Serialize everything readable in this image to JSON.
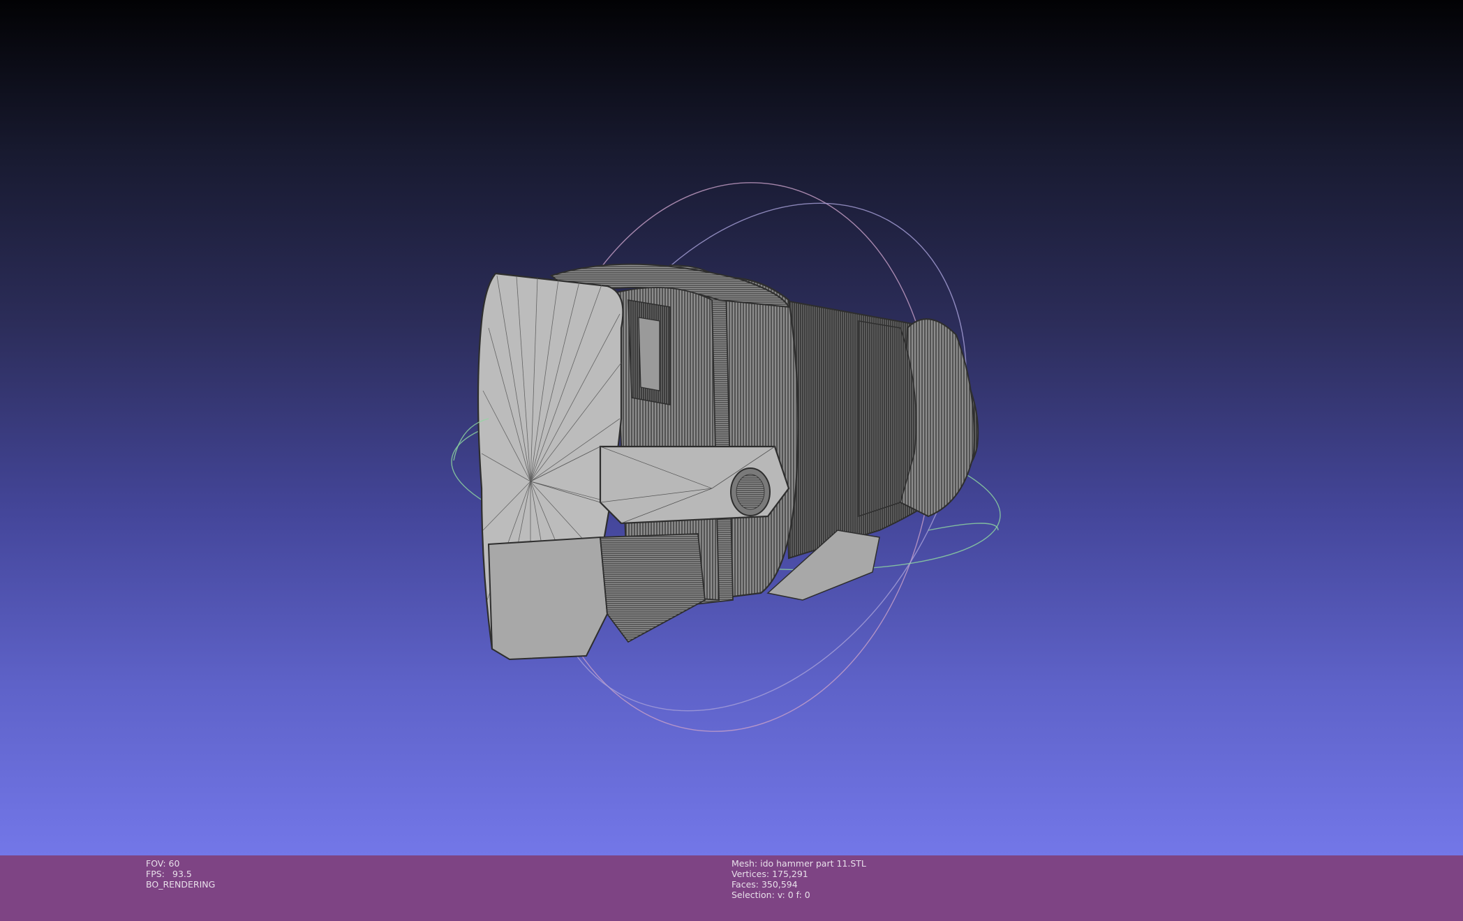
{
  "viewer": {
    "mesh_name": "ido hammer part 11.STL",
    "colors": {
      "background_top": "#020204",
      "background_bottom": "#7377e8",
      "statusbar": "#7e4484",
      "mesh_fill": "#b4b4b4",
      "mesh_lines": "#3c3c3c"
    }
  },
  "status_left": {
    "fov_label": "FOV:",
    "fov_value": "60",
    "fps_label": "FPS:",
    "fps_value": "93.5",
    "mode": "BO_RENDERING"
  },
  "status_right": {
    "mesh_label": "Mesh:",
    "mesh_value": "ido hammer part 11.STL",
    "vertices_label": "Vertices:",
    "vertices_value": "175,291",
    "faces_label": "Faces:",
    "faces_value": "350,594",
    "selection_label": "Selection:",
    "selection_value": "v: 0 f: 0"
  }
}
